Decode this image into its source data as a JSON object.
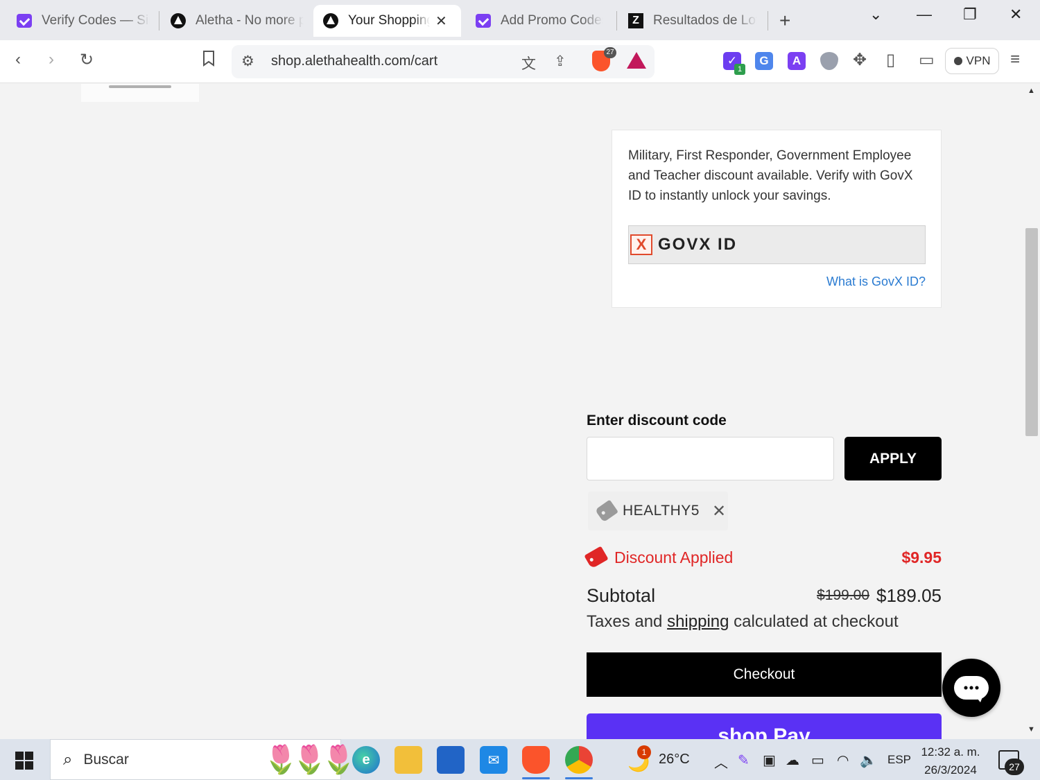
{
  "browser": {
    "tabs": [
      {
        "title": "Verify Codes — SimplyCodes",
        "favicon": "simplycodes-icon",
        "active": false
      },
      {
        "title": "Aletha - No more pain",
        "favicon": "aletha-icon",
        "active": false
      },
      {
        "title": "Your Shopping Cart",
        "favicon": "aletha-icon",
        "active": true
      },
      {
        "title": "Add Promo Codes - SimplyCodes",
        "favicon": "simplycodes-icon",
        "active": false
      },
      {
        "title": "Resultados de Lotería",
        "favicon": "z-icon",
        "active": false
      }
    ],
    "url": "shop.alethahealth.com/cart",
    "brave_badge": "27",
    "ext_badge": "1",
    "vpn_label": "VPN"
  },
  "page": {
    "govx": {
      "description": "Military, First Responder, Government Employee and Teacher discount available. Verify with GovX ID to instantly unlock your savings.",
      "button_label": "GOVX ID",
      "logo_mark": "X",
      "link": "What is GovX ID?"
    },
    "discount": {
      "label": "Enter discount code",
      "input_value": "",
      "input_placeholder": "",
      "apply_label": "APPLY",
      "applied_code": "HEALTHY5",
      "remove_glyph": "✕",
      "applied_text": "Discount Applied",
      "amount": "$9.95"
    },
    "subtotal": {
      "label": "Subtotal",
      "original": "$199.00",
      "final": "$189.05",
      "taxes_prefix": "Taxes and ",
      "taxes_link": "shipping",
      "taxes_suffix": " calculated at checkout"
    },
    "checkout_label": "Checkout",
    "shoppay_label": "shop Pay"
  },
  "taskbar": {
    "search_placeholder": "Buscar",
    "weather_temp": "26°C",
    "weather_notice": "1",
    "language": "ESP",
    "time": "12:32 a. m.",
    "date": "26/3/2024",
    "notification_count": "27"
  },
  "colors": {
    "accent_red": "#e02626",
    "link_blue": "#2a7bd1",
    "shoppay_purple": "#5a31f4",
    "govx_orange": "#e04a2c"
  }
}
